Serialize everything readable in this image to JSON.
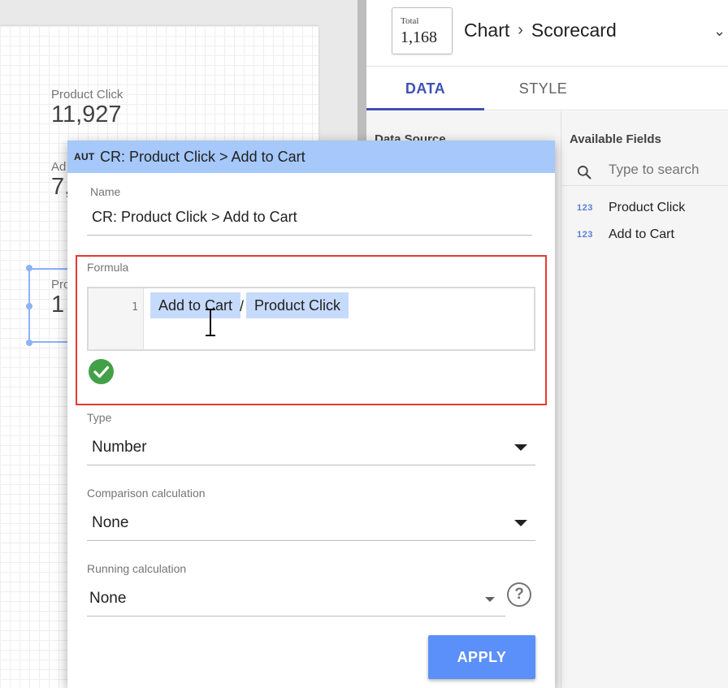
{
  "canvas": {
    "scorecards": [
      {
        "label": "Product Click",
        "value": "11,927"
      },
      {
        "label": "Ad",
        "value": "7,"
      },
      {
        "label": "Pro",
        "value": "1"
      }
    ]
  },
  "panel": {
    "chart_icon": {
      "label": "Total",
      "value": "1,168"
    },
    "breadcrumb": {
      "first": "Chart",
      "separator": "›",
      "second": "Scorecard"
    },
    "expand_glyph": "⌄",
    "tabs": [
      {
        "label": "DATA",
        "active": true
      },
      {
        "label": "STYLE",
        "active": false
      }
    ],
    "data_source_heading": "Data Source",
    "available_fields": {
      "title": "Available Fields",
      "search_placeholder": "Type to search",
      "items": [
        {
          "type_icon": "123",
          "label": "Product Click"
        },
        {
          "type_icon": "123",
          "label": "Add to Cart"
        }
      ]
    }
  },
  "dialog": {
    "type_tag": "AUT",
    "title": "CR: Product Click > Add to Cart",
    "name_label": "Name",
    "name_value": "CR: Product Click > Add to Cart",
    "formula_label": "Formula",
    "formula": {
      "line_number": "1",
      "tokens": [
        "Add to Cart",
        "/",
        "Product Click"
      ]
    },
    "type": {
      "label": "Type",
      "value": "Number"
    },
    "comparison": {
      "label": "Comparison calculation",
      "value": "None"
    },
    "running": {
      "label": "Running calculation",
      "value": "None"
    },
    "help_glyph": "?",
    "apply_label": "APPLY"
  },
  "colors": {
    "dialog_header": "#a6c8fb",
    "chip": "#c6dafc",
    "formula_highlight_border": "#e53935",
    "valid_check": "#43a047",
    "apply_button": "#5b8ff9",
    "active_tab": "#3f51b5"
  }
}
